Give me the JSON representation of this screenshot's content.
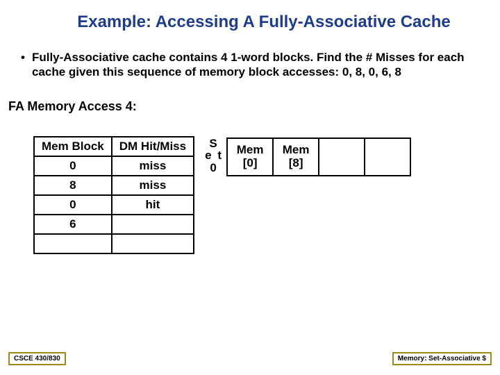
{
  "title": "Example: Accessing A Fully-Associative Cache",
  "bullet": "Fully-Associative cache contains 4 1-word blocks. Find the # Misses for each cache given this sequence of memory block accesses: 0, 8, 0, 6, 8",
  "subhead": "FA Memory Access 4:",
  "access_table": {
    "headers": [
      "Mem Block",
      "DM Hit/Miss"
    ],
    "rows": [
      [
        "0",
        "miss"
      ],
      [
        "8",
        "miss"
      ],
      [
        "0",
        "hit"
      ],
      [
        "6",
        ""
      ],
      [
        "",
        ""
      ]
    ]
  },
  "set_label": {
    "l1": "S",
    "l2": "e t",
    "l3": "0"
  },
  "cache_cells": [
    "Mem\n[0]",
    "Mem\n[8]",
    "",
    ""
  ],
  "footer_left": "CSCE 430/830",
  "footer_right": "Memory: Set-Associative $",
  "chart_data": {
    "type": "table",
    "title": "FA Memory Access 4",
    "access_sequence": [
      {
        "mem_block": 0,
        "result": "miss"
      },
      {
        "mem_block": 8,
        "result": "miss"
      },
      {
        "mem_block": 0,
        "result": "hit"
      },
      {
        "mem_block": 6,
        "result": null
      }
    ],
    "cache_state": {
      "set": 0,
      "blocks": [
        "Mem[0]",
        "Mem[8]",
        null,
        null
      ]
    }
  }
}
